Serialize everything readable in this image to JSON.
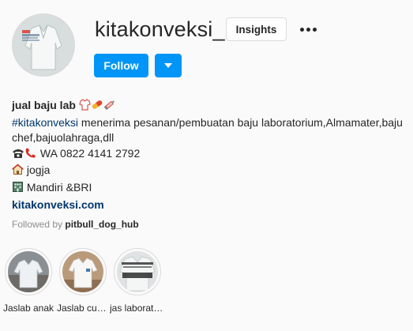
{
  "profile": {
    "username": "kitakonveksi_",
    "insights_label": "Insights",
    "follow_label": "Follow"
  },
  "bio": {
    "name": "jual baju lab",
    "hashtag": "#kitakonveksi",
    "description_line1": " menerima pesanan/pembuatan baju laboratorium,Almamater,baju",
    "description_line2": "chef,bajuolahraga,dll",
    "phone": "WA 0822 4141 2792",
    "location": "jogja",
    "bank": "Mandiri &BRI",
    "website": "kitakonveksi.com"
  },
  "followed_by": {
    "prefix": "Followed by ",
    "user": "pitbull_dog_hub"
  },
  "highlights": [
    {
      "label": "Jaslab anak"
    },
    {
      "label": "Jaslab custom"
    },
    {
      "label": "jas laboratorium"
    }
  ],
  "icons": {
    "more": "more-dots-icon",
    "dropdown": "chevron-down-icon"
  },
  "colors": {
    "accent": "#0095f6",
    "link": "#00376b",
    "muted": "#8e8e8e"
  }
}
